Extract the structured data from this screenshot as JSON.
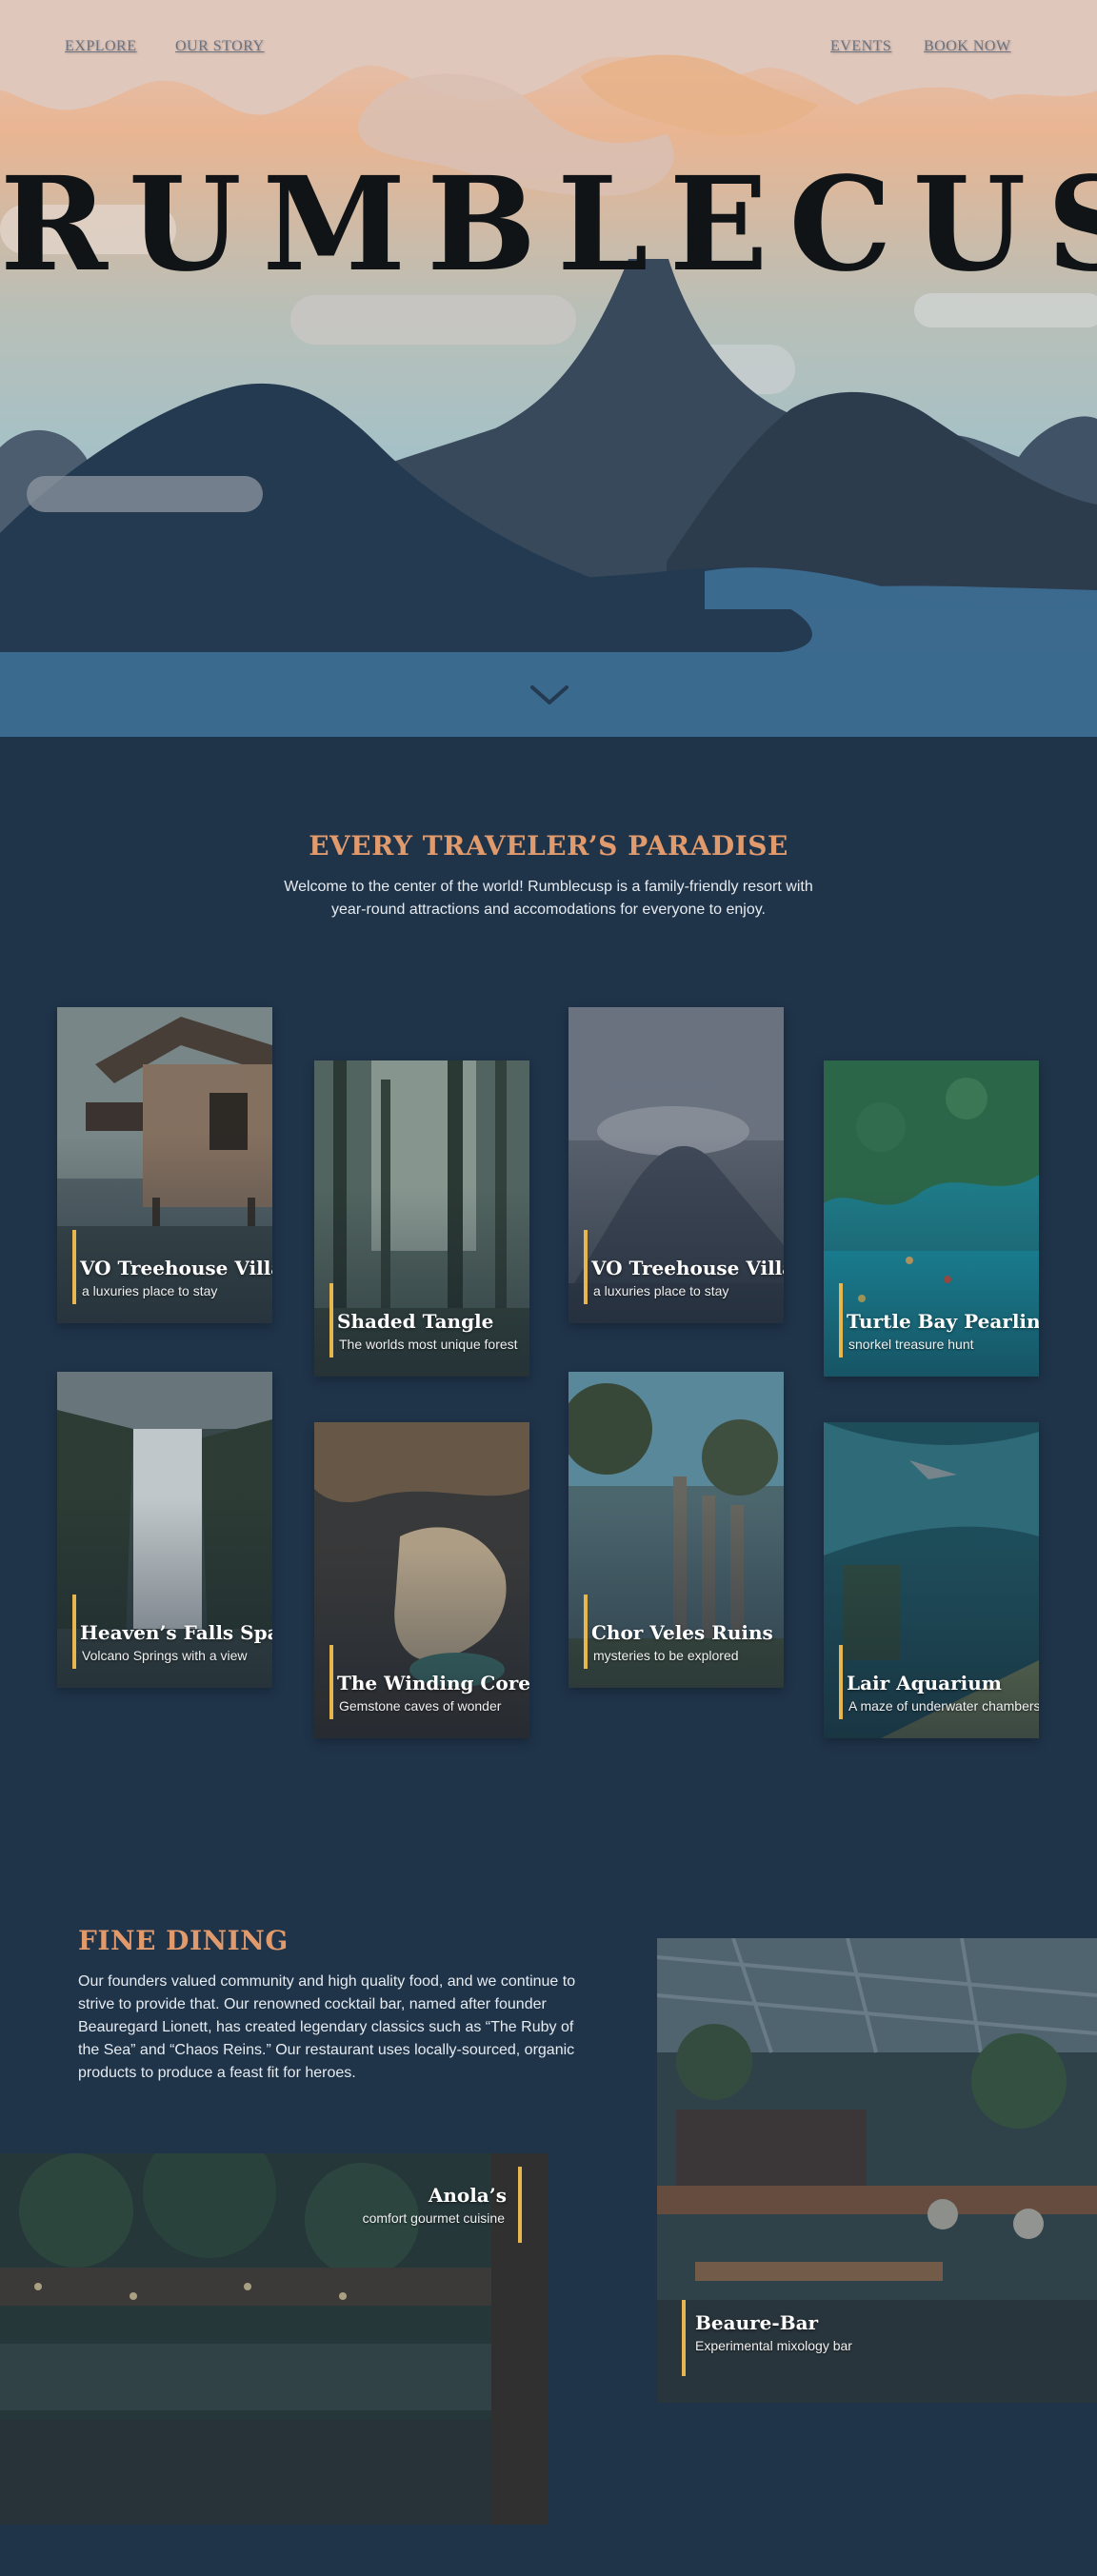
{
  "nav": {
    "explore": "EXPLORE",
    "our_story": "OUR STORY",
    "events": "EVENTS",
    "book_now": "BOOK NOW"
  },
  "hero": {
    "title": "RUMBLECUSP",
    "scroll_icon": "chevron-down-icon"
  },
  "intro": {
    "title": "EVERY TRAVELER’S PARADISE",
    "text": "Welcome to the center of the world! Rumblecusp is a family-friendly resort with year-round attractions and accomodations for everyone to enjoy."
  },
  "cards": [
    {
      "title": "VO Treehouse Villas",
      "subtitle": "a luxuries place to stay"
    },
    {
      "title": "Shaded Tangle",
      "subtitle": "The worlds most unique forest"
    },
    {
      "title": "VO Treehouse Villas",
      "subtitle": "a luxuries place to stay"
    },
    {
      "title": "Turtle Bay Pearling",
      "subtitle": "snorkel treasure hunt"
    },
    {
      "title": "Heaven’s Falls Spa",
      "subtitle": "Volcano Springs with a view"
    },
    {
      "title": "The Winding Core",
      "subtitle": "Gemstone caves of wonder"
    },
    {
      "title": "Chor Veles Ruins",
      "subtitle": "mysteries to be explored"
    },
    {
      "title": "Lair Aquarium",
      "subtitle": "A maze of underwater chambers"
    }
  ],
  "dining": {
    "title": "FINE DINING",
    "text": "Our founders valued community and high quality food, and we continue to strive to provide that. Our renowned cocktail bar, named after founder Beauregard Lionett, has created legendary classics such as “The Ruby of the Sea” and “Chaos Reins.” Our restaurant uses locally-sourced, organic products to produce a feast fit for heroes.",
    "restaurant": {
      "title": "Anola’s",
      "subtitle": "comfort gourmet cuisine"
    },
    "bar": {
      "title": "Beaure-Bar",
      "subtitle": "Experimental mixology bar"
    }
  },
  "colors": {
    "background": "#1f3349",
    "accent": "#e09a6c",
    "card_bar": "#e8b64f"
  }
}
